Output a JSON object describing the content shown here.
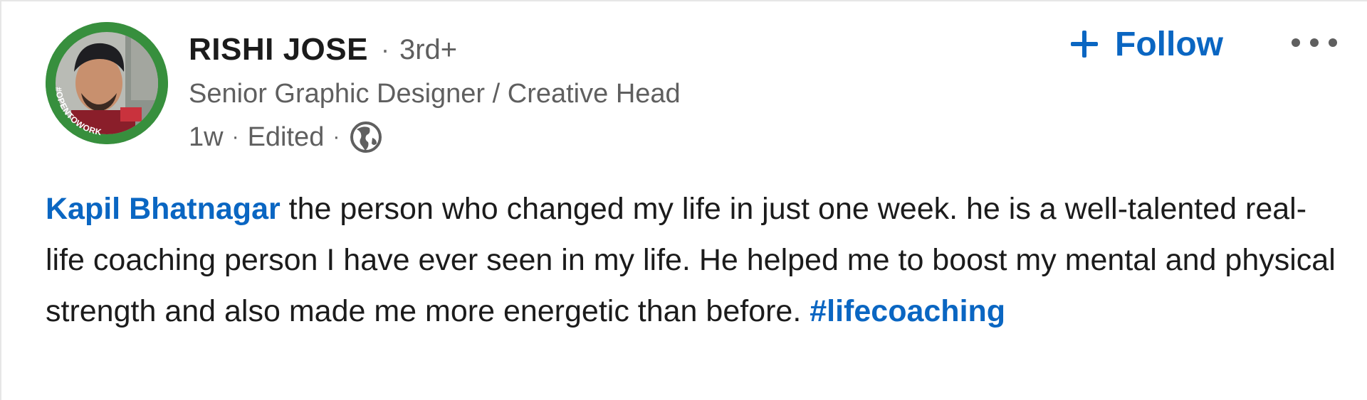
{
  "author": {
    "name": "RISHI JOSE",
    "separator": "·",
    "degree": "3rd+",
    "headline": "Senior Graphic Designer / Creative Head",
    "avatar_badge": "#OPENTOWORK"
  },
  "meta": {
    "time": "1w",
    "edited": "Edited",
    "separator": "·",
    "visibility_icon": "globe-icon"
  },
  "actions": {
    "follow_label": "Follow",
    "follow_icon": "plus-icon",
    "more_icon": "ellipsis-icon"
  },
  "post": {
    "mention": "Kapil Bhatnagar",
    "text": " the person who changed my life in just one week. he is a well-talented real-life coaching person I have ever seen in my life. He helped me to boost my mental and physical strength and also made me more energetic than before. ",
    "hashtag": "#lifecoaching"
  },
  "colors": {
    "link": "#0a66c2",
    "text_primary": "#1b1b1b",
    "text_secondary": "#5f5f5f",
    "open_to_work_ring": "#378f3d"
  }
}
